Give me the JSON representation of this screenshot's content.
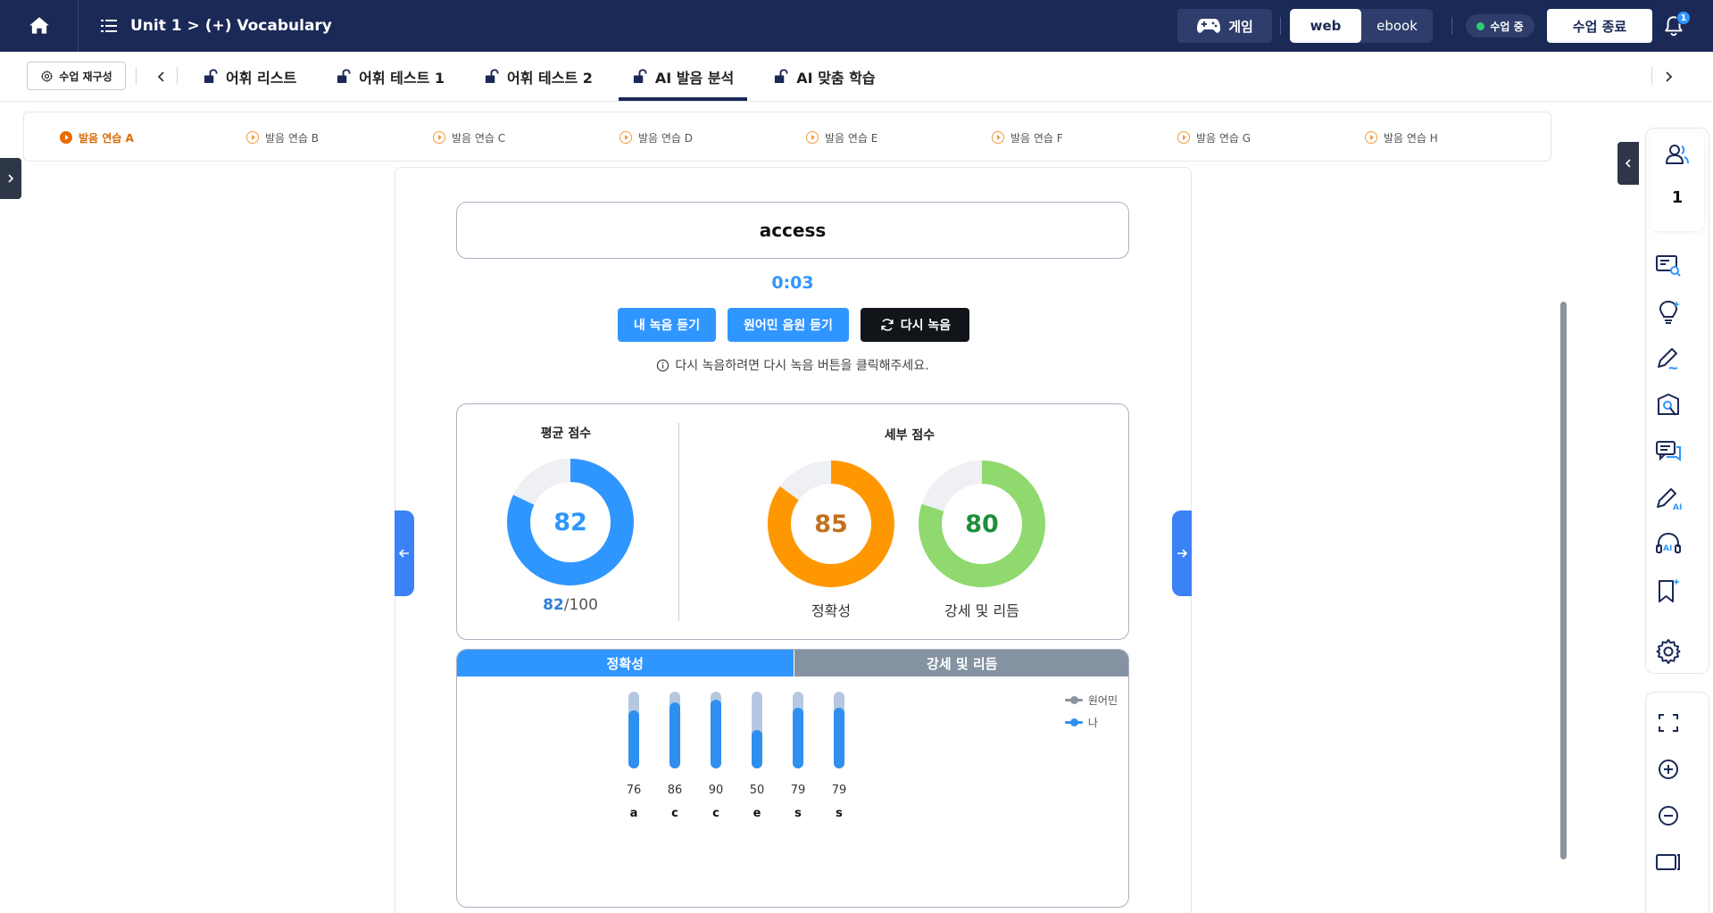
{
  "topbar": {
    "breadcrumb": "Unit 1 > (+) Vocabulary",
    "game_label": "게임",
    "mode_web": "web",
    "mode_ebook": "ebook",
    "status": "수업 중",
    "end_button": "수업 종료",
    "notification_count": "1"
  },
  "tabbar": {
    "reconfigure": "수업 재구성",
    "tabs": [
      {
        "label": "어휘 리스트"
      },
      {
        "label": "어휘 테스트 1"
      },
      {
        "label": "어휘 테스트 2"
      },
      {
        "label": "AI 발음 분석",
        "active": true
      },
      {
        "label": "AI 맞춤 학습"
      }
    ]
  },
  "subtabs": [
    "발음 연습 A",
    "발음 연습 B",
    "발음 연습 C",
    "발음 연습 D",
    "발음 연습 E",
    "발음 연습 F",
    "발음 연습 G",
    "발음 연습 H"
  ],
  "practice": {
    "word": "access",
    "timer": "0:03",
    "buttons": {
      "my_recording": "내 녹음 듣기",
      "native_audio": "원어민 음원 듣기",
      "re_record": "다시 녹음"
    },
    "hint": "다시 녹음하려면 다시 녹음 버튼을 클릭해주세요."
  },
  "scores": {
    "average_label": "평균 점수",
    "average": 82,
    "average_value": "82",
    "average_max": "/100",
    "detail_label": "세부 점수",
    "accuracy": 85,
    "accuracy_value": "85",
    "accuracy_label": "정확성",
    "stress": 80,
    "stress_value": "80",
    "stress_label": "강세 및 리듬"
  },
  "colors": {
    "average": "#2f96ff",
    "accuracy": "#ff9800",
    "accuracy_text": "#c2711c",
    "stress": "#8fd96e",
    "stress_text": "#1e8f3a",
    "track": "#eef0f4"
  },
  "detail": {
    "tab_accuracy": "정확성",
    "tab_stress": "강세 및 리듬",
    "legend_native": "원어민",
    "legend_me": "나"
  },
  "chart_data": {
    "type": "bar",
    "categories": [
      "a",
      "c",
      "c",
      "e",
      "s",
      "s"
    ],
    "series": [
      {
        "name": "나",
        "values": [
          76,
          86,
          90,
          50,
          79,
          79
        ]
      }
    ],
    "ylim": [
      0,
      100
    ]
  },
  "right_toolbar": {
    "user_count": "1",
    "icons": [
      "students-icon",
      "screen-search-icon",
      "lightbulb-icon",
      "pen-icon",
      "book-search-icon",
      "chat-icon",
      "ai-pen-icon",
      "ai-headset-icon",
      "bookmark-icon",
      "settings-icon",
      "fullscreen-icon",
      "zoom-in-icon",
      "zoom-out-icon",
      "screen-split-icon"
    ]
  }
}
